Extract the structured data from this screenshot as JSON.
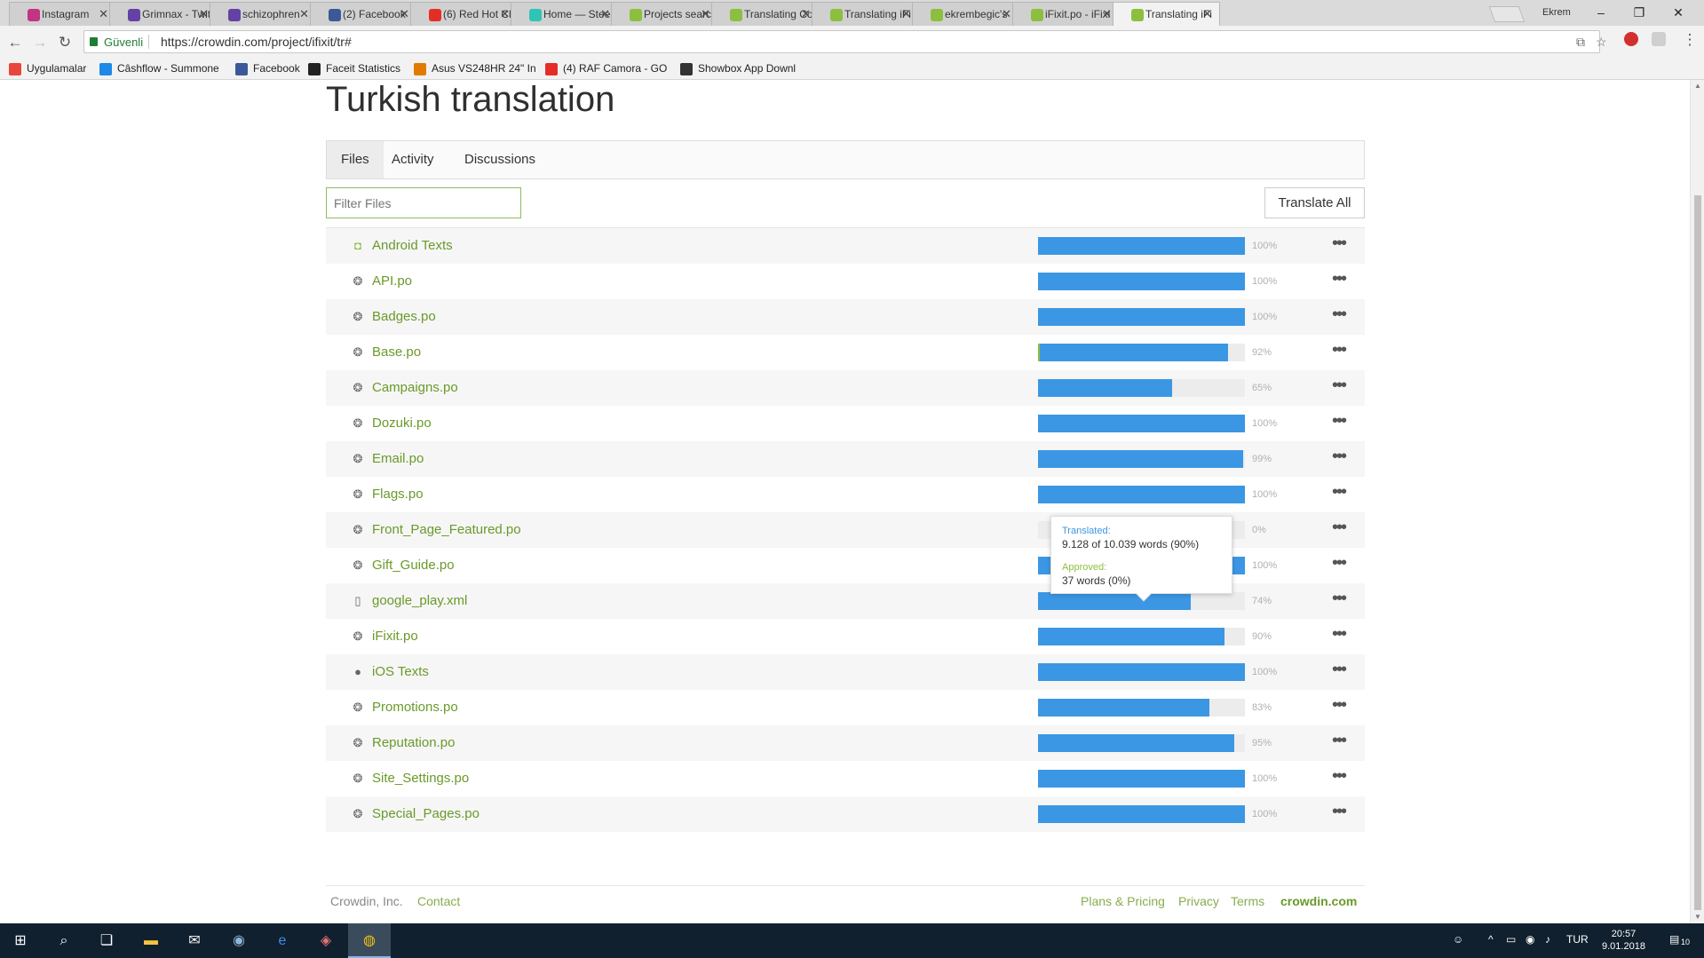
{
  "browser": {
    "tabs": [
      {
        "label": "Instagram",
        "color": "#c13584"
      },
      {
        "label": "Grimnax - Twit",
        "color": "#6441a4"
      },
      {
        "label": "schizophren",
        "color": "#6441a4"
      },
      {
        "label": "(2) Facebook",
        "color": "#3b5998"
      },
      {
        "label": "(6) Red Hot Ch",
        "color": "#e52d27"
      },
      {
        "label": "Home — Steen",
        "color": "#2ec4b6"
      },
      {
        "label": "Projects search",
        "color": "#8cbf3f"
      },
      {
        "label": "Translating Co",
        "color": "#8cbf3f"
      },
      {
        "label": "Translating iFi",
        "color": "#8cbf3f"
      },
      {
        "label": "ekrembegic's",
        "color": "#8cbf3f"
      },
      {
        "label": "iFixit.po - iFixi",
        "color": "#8cbf3f"
      },
      {
        "label": "Translating iFi",
        "color": "#8cbf3f"
      }
    ],
    "user": "Ekrem",
    "secure_label": "Güvenli",
    "url": "https://crowdin.com/project/ifixit/tr#",
    "bookmarks": [
      {
        "label": "Uygulamalar",
        "color": "#e8453c"
      },
      {
        "label": "Câshflow - Summone",
        "color": "#1e88e5"
      },
      {
        "label": "Facebook",
        "color": "#3b5998"
      },
      {
        "label": "Faceit Statistics",
        "color": "#222222"
      },
      {
        "label": "Asus VS248HR 24\" In",
        "color": "#e07b00"
      },
      {
        "label": "(4) RAF Camora - GO",
        "color": "#e52d27"
      },
      {
        "label": "Showbox App Downl",
        "color": "#333333"
      }
    ]
  },
  "page": {
    "title": "Turkish translation",
    "tabs": [
      "Files",
      "Activity",
      "Discussions"
    ],
    "filter_placeholder": "Filter Files",
    "translate_all": "Translate All",
    "files": [
      {
        "name": "Android Texts",
        "icon": "android-icon",
        "percent": 100,
        "percent_label": "100%"
      },
      {
        "name": "API.po",
        "icon": "gettext-icon",
        "percent": 100,
        "percent_label": "100%"
      },
      {
        "name": "Badges.po",
        "icon": "gettext-icon",
        "percent": 100,
        "percent_label": "100%"
      },
      {
        "name": "Base.po",
        "icon": "gettext-icon",
        "percent": 92,
        "percent_label": "92%"
      },
      {
        "name": "Campaigns.po",
        "icon": "gettext-icon",
        "percent": 65,
        "percent_label": "65%"
      },
      {
        "name": "Dozuki.po",
        "icon": "gettext-icon",
        "percent": 100,
        "percent_label": "100%"
      },
      {
        "name": "Email.po",
        "icon": "gettext-icon",
        "percent": 99,
        "percent_label": "99%"
      },
      {
        "name": "Flags.po",
        "icon": "gettext-icon",
        "percent": 100,
        "percent_label": "100%"
      },
      {
        "name": "Front_Page_Featured.po",
        "icon": "gettext-icon",
        "percent": 0,
        "percent_label": "0%"
      },
      {
        "name": "Gift_Guide.po",
        "icon": "gettext-icon",
        "percent": 100,
        "percent_label": "100%"
      },
      {
        "name": "google_play.xml",
        "icon": "document-icon",
        "percent": 74,
        "percent_label": "74%"
      },
      {
        "name": "iFixit.po",
        "icon": "gettext-icon",
        "percent": 90,
        "percent_label": "90%"
      },
      {
        "name": "iOS Texts",
        "icon": "apple-icon",
        "percent": 100,
        "percent_label": "100%"
      },
      {
        "name": "Promotions.po",
        "icon": "gettext-icon",
        "percent": 83,
        "percent_label": "83%"
      },
      {
        "name": "Reputation.po",
        "icon": "gettext-icon",
        "percent": 95,
        "percent_label": "95%"
      },
      {
        "name": "Site_Settings.po",
        "icon": "gettext-icon",
        "percent": 100,
        "percent_label": "100%"
      },
      {
        "name": "Special_Pages.po",
        "icon": "gettext-icon",
        "percent": 100,
        "percent_label": "100%"
      }
    ],
    "tooltip": {
      "translated_label": "Translated:",
      "translated_value": "9.128 of 10.039 words (90%)",
      "approved_label": "Approved:",
      "approved_value": "37 words (0%)"
    },
    "footer": {
      "company": "Crowdin, Inc.",
      "contact": "Contact",
      "plans": "Plans & Pricing",
      "privacy": "Privacy",
      "terms": "Terms",
      "site": "crowdin.com"
    },
    "colors": {
      "progress": "#3b97e3",
      "approved": "#8cbf3f",
      "link": "#6a9a2a"
    }
  },
  "taskbar": {
    "language": "TUR",
    "time": "20:57",
    "date": "9.01.2018",
    "notifications": "10"
  }
}
